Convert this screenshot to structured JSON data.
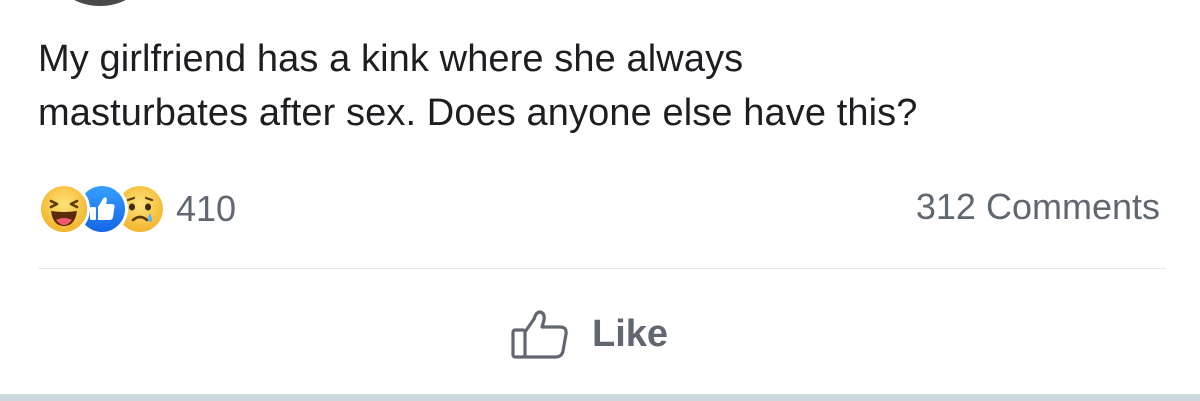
{
  "post": {
    "text_line1": "My girlfriend has a kink where she always",
    "text_line2": "masturbates after sex. Does anyone else have this?"
  },
  "reactions": {
    "icons": [
      "haha-icon",
      "like-icon",
      "sad-icon"
    ],
    "count": "410"
  },
  "comments": {
    "count_label": "312 Comments"
  },
  "actions": {
    "like_label": "Like"
  },
  "colors": {
    "text": "#1c1e21",
    "secondary_text": "#606770",
    "like_blue": "#1877f2",
    "emoji_yellow": "#f7c43b"
  }
}
